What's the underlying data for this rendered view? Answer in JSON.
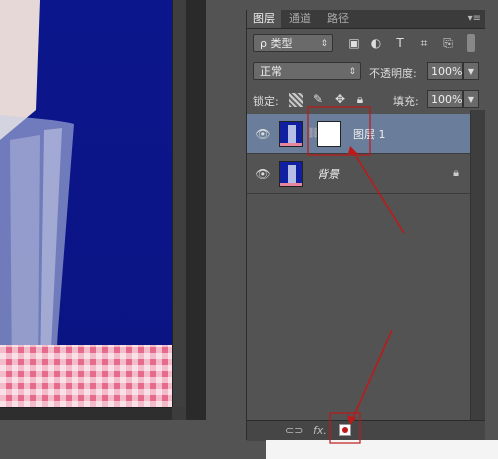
{
  "tabs": [
    "图层",
    "通道",
    "路径"
  ],
  "filter": {
    "label": "ρ 类型"
  },
  "blend_mode": "正常",
  "opacity": {
    "label": "不透明度:",
    "value": "100%"
  },
  "lock": {
    "label": "锁定:"
  },
  "fill": {
    "label": "填充:",
    "value": "100%"
  },
  "layers": [
    {
      "name": "图层 1",
      "selected": true,
      "has_mask": true
    },
    {
      "name": "背景",
      "selected": false,
      "locked": true
    }
  ],
  "bottom_bar": {
    "fx_label": "fx."
  },
  "colors": {
    "accent_annotation": "#c01818",
    "selected_layer": "#6a7d9a",
    "panel_bg": "#535353"
  },
  "icons": [
    "search-icon",
    "image-filter-icon",
    "adjustment-filter-icon",
    "text-filter-icon",
    "shape-filter-icon",
    "smart-object-filter-icon",
    "toggle-filter-icon",
    "checker-lock-icon",
    "brush-lock-icon",
    "move-lock-icon",
    "padlock-icon",
    "eye-icon",
    "link-icon",
    "add-mask-icon"
  ]
}
